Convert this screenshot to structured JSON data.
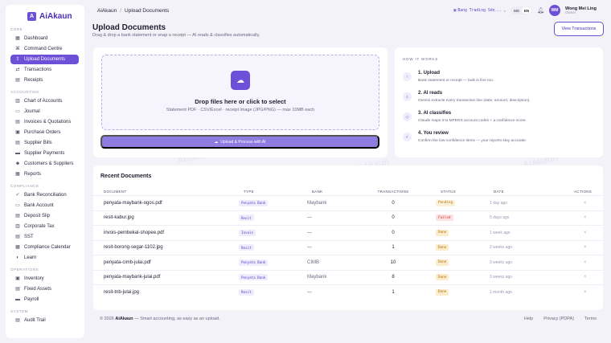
{
  "brand": {
    "name": "AiAkaun",
    "logo_letter": "A"
  },
  "breadcrumb": {
    "root": "AiAkaun",
    "separator": "/",
    "current": "Upload Documents"
  },
  "topbar": {
    "company": "Bang Trading Sdn...",
    "lang_options": [
      "MS",
      "EN"
    ],
    "lang_selected": "EN",
    "user": {
      "initials": "WM",
      "name": "Wong Mei Ling",
      "role": "Owner"
    }
  },
  "sidebar": {
    "sections": [
      {
        "label": "Core",
        "items": [
          {
            "label": "Dashboard",
            "icon": "dashboard-icon"
          },
          {
            "label": "Command Centre",
            "icon": "command-icon"
          },
          {
            "label": "Upload Documents",
            "icon": "upload-icon",
            "active": true
          },
          {
            "label": "Transactions",
            "icon": "transactions-icon"
          },
          {
            "label": "Receipts",
            "icon": "receipt-icon"
          }
        ]
      },
      {
        "label": "Accounting",
        "items": [
          {
            "label": "Chart of Accounts",
            "icon": "chart-icon"
          },
          {
            "label": "Journal",
            "icon": "journal-icon"
          },
          {
            "label": "Invoices & Quotations",
            "icon": "invoice-icon"
          },
          {
            "label": "Purchase Orders",
            "icon": "purchase-icon"
          },
          {
            "label": "Supplier Bills",
            "icon": "bill-icon"
          },
          {
            "label": "Supplier Payments",
            "icon": "payment-icon"
          },
          {
            "label": "Customers & Suppliers",
            "icon": "people-icon"
          },
          {
            "label": "Reports",
            "icon": "report-icon"
          }
        ]
      },
      {
        "label": "Compliance",
        "items": [
          {
            "label": "Bank Reconciliation",
            "icon": "check-icon"
          },
          {
            "label": "Bank Account",
            "icon": "bank-icon"
          },
          {
            "label": "Deposit Slip",
            "icon": "deposit-icon"
          },
          {
            "label": "Corporate Tax",
            "icon": "tax-icon"
          },
          {
            "label": "SST",
            "icon": "sst-icon"
          },
          {
            "label": "Compliance Calendar",
            "icon": "calendar-icon"
          },
          {
            "label": "Learn",
            "icon": "learn-icon"
          }
        ]
      },
      {
        "label": "Operations",
        "items": [
          {
            "label": "Inventory",
            "icon": "inventory-icon"
          },
          {
            "label": "Fixed Assets",
            "icon": "assets-icon"
          },
          {
            "label": "Payroll",
            "icon": "payroll-icon"
          }
        ]
      },
      {
        "label": "System",
        "items": [
          {
            "label": "Audit Trail",
            "icon": "audit-icon"
          }
        ]
      }
    ]
  },
  "header": {
    "title": "Upload Documents",
    "subtitle": "Drag & drop a bank statement or snap a receipt — AI reads & classifies automatically.",
    "view_transactions": "View Transactions"
  },
  "upload": {
    "drop_title": "Drop files here or click to select",
    "drop_sub": "Statement PDF · CSV/Excel · receipt image (JPG/PNG) — max 10MB each",
    "process_label": "Upload & Process with AI"
  },
  "how": {
    "title": "How it works",
    "steps": [
      {
        "title": "1. Upload",
        "desc": "Bank statement or receipt — bulk is fine too.",
        "icon": "upload-step-icon"
      },
      {
        "title": "2. AI reads",
        "desc": "Gemini extracts every transaction line (date, amount, description).",
        "icon": "search-step-icon"
      },
      {
        "title": "3. AI classifies",
        "desc": "Claude maps it to MPERS account codes + a confidence score.",
        "icon": "tag-step-icon"
      },
      {
        "title": "4. You review",
        "desc": "Confirm the low-confidence items — your reports stay accurate.",
        "icon": "review-step-icon"
      }
    ]
  },
  "recent": {
    "title": "Recent Documents",
    "columns": [
      "DOCUMENT",
      "TYPE",
      "BANK",
      "TRANSACTIONS",
      "STATUS",
      "DATE",
      "ACTIONS"
    ],
    "rows": [
      {
        "doc": "penyata-maybank-ogos.pdf",
        "type": "Penyata Bank",
        "bank": "Maybank",
        "tx": "0",
        "status": "Pending",
        "date": "1 day ago"
      },
      {
        "doc": "resit-kabur.jpg",
        "type": "Resit",
        "bank": "—",
        "tx": "0",
        "status": "Failed",
        "date": "5 days ago"
      },
      {
        "doc": "invois-pembekal-shopee.pdf",
        "type": "Invois",
        "bank": "—",
        "tx": "0",
        "status": "Done",
        "date": "1 week ago"
      },
      {
        "doc": "resit-borong-segar-1102.jpg",
        "type": "Resit",
        "bank": "—",
        "tx": "1",
        "status": "Done",
        "date": "2 weeks ago"
      },
      {
        "doc": "penyata-cimb-julai.pdf",
        "type": "Penyata Bank",
        "bank": "CIMB",
        "tx": "10",
        "status": "Done",
        "date": "3 weeks ago"
      },
      {
        "doc": "penyata-maybank-julai.pdf",
        "type": "Penyata Bank",
        "bank": "Maybank",
        "tx": "8",
        "status": "Done",
        "date": "3 weeks ago"
      },
      {
        "doc": "resit-tnb-julai.jpg",
        "type": "Resit",
        "bank": "—",
        "tx": "1",
        "status": "Done",
        "date": "1 month ago"
      }
    ],
    "action_symbol": "×"
  },
  "footer": {
    "copyright_prefix": "© 2026",
    "copyright_brand": "AiAkaun",
    "copyright_suffix": "— Smart accounting, as easy as an upload.",
    "links": [
      "Help",
      "Privacy (PDPA)",
      "Terms"
    ]
  },
  "status_colors": {
    "Pending": {
      "bg": "#fdf0d8",
      "fg": "#b07414"
    },
    "Failed": {
      "bg": "#fde2e2",
      "fg": "#c0392b"
    },
    "Done": {
      "bg": "#fdeccc",
      "fg": "#a8700f"
    }
  },
  "accent": "#6d4fd8"
}
